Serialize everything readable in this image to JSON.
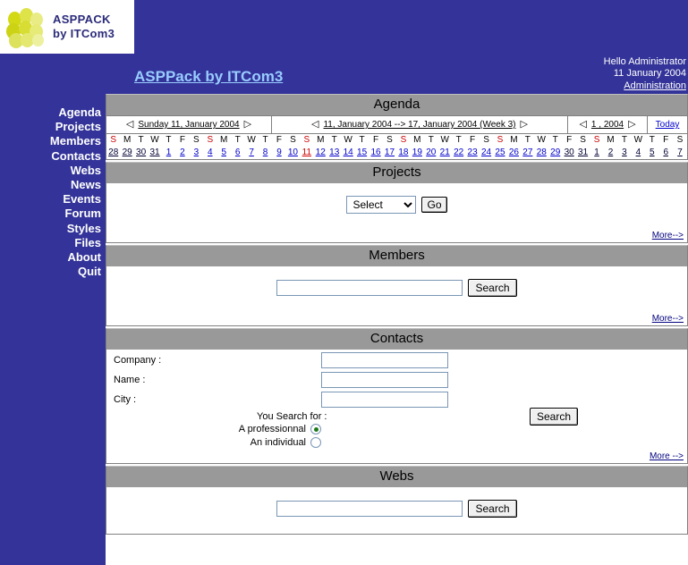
{
  "branding": {
    "logo_line1": "ASPPACK",
    "logo_line2": "by ITCom3",
    "site_title": "ASPPack by ITCom3",
    "accent_blue": "#333399",
    "link_blue": "#0000cc",
    "panel_gray": "#999999",
    "logo_yellow": "#d8dd33"
  },
  "user": {
    "greeting": "Hello  Administrator",
    "date": "11 January 2004",
    "admin_link": "Administration"
  },
  "sidebar": {
    "items": [
      {
        "label": "Agenda"
      },
      {
        "label": "Projects"
      },
      {
        "label": "Members"
      },
      {
        "label": "Contacts"
      },
      {
        "label": "Webs"
      },
      {
        "label": "News"
      },
      {
        "label": "Events"
      },
      {
        "label": "Forum"
      },
      {
        "label": "Styles"
      },
      {
        "label": "Files"
      },
      {
        "label": "About"
      },
      {
        "label": "Quit"
      }
    ]
  },
  "agenda": {
    "title": "Agenda",
    "day_label": "Sunday 11, January 2004",
    "week_label": "11, January 2004 --> 17, January 2004  (Week 3)",
    "year_label": "1 , 2004",
    "today_label": "Today",
    "prev_arrow": "◁",
    "next_arrow": "▷",
    "dow": [
      "S",
      "M",
      "T",
      "W",
      "T",
      "F",
      "S",
      "S",
      "M",
      "T",
      "W",
      "T",
      "F",
      "S",
      "S",
      "M",
      "T",
      "W",
      "T",
      "F",
      "S",
      "S",
      "M",
      "T",
      "W",
      "T",
      "F",
      "S",
      "S",
      "M",
      "T",
      "W",
      "T",
      "F",
      "S"
    ],
    "days": [
      {
        "n": "28",
        "style": "dark"
      },
      {
        "n": "29",
        "style": "dark"
      },
      {
        "n": "30",
        "style": "dark"
      },
      {
        "n": "31",
        "style": "dark"
      },
      {
        "n": "1",
        "style": "blue"
      },
      {
        "n": "2",
        "style": "blue"
      },
      {
        "n": "3",
        "style": "blue"
      },
      {
        "n": "4",
        "style": "blue"
      },
      {
        "n": "5",
        "style": "blue"
      },
      {
        "n": "6",
        "style": "blue"
      },
      {
        "n": "7",
        "style": "blue"
      },
      {
        "n": "8",
        "style": "blue"
      },
      {
        "n": "9",
        "style": "blue"
      },
      {
        "n": "10",
        "style": "blue"
      },
      {
        "n": "11",
        "style": "today"
      },
      {
        "n": "12",
        "style": "blue"
      },
      {
        "n": "13",
        "style": "blue"
      },
      {
        "n": "14",
        "style": "blue"
      },
      {
        "n": "15",
        "style": "blue"
      },
      {
        "n": "16",
        "style": "blue"
      },
      {
        "n": "17",
        "style": "blue"
      },
      {
        "n": "18",
        "style": "blue"
      },
      {
        "n": "19",
        "style": "blue"
      },
      {
        "n": "20",
        "style": "blue"
      },
      {
        "n": "21",
        "style": "blue"
      },
      {
        "n": "22",
        "style": "blue"
      },
      {
        "n": "23",
        "style": "blue"
      },
      {
        "n": "24",
        "style": "blue"
      },
      {
        "n": "25",
        "style": "blue"
      },
      {
        "n": "26",
        "style": "blue"
      },
      {
        "n": "27",
        "style": "blue"
      },
      {
        "n": "28",
        "style": "blue"
      },
      {
        "n": "29",
        "style": "blue"
      },
      {
        "n": "30",
        "style": "dark"
      },
      {
        "n": "31",
        "style": "dark"
      },
      {
        "n": "1",
        "style": "dark"
      },
      {
        "n": "2",
        "style": "dark"
      },
      {
        "n": "3",
        "style": "dark"
      },
      {
        "n": "4",
        "style": "dark"
      },
      {
        "n": "5",
        "style": "dark"
      },
      {
        "n": "6",
        "style": "dark"
      },
      {
        "n": "7",
        "style": "dark"
      }
    ]
  },
  "projects": {
    "title": "Projects",
    "select_value": "Select",
    "select_options": [
      "Select"
    ],
    "go_label": "Go",
    "more_label": "More-->"
  },
  "members": {
    "title": "Members",
    "search_value": "",
    "search_button": "Search",
    "more_label": "More-->"
  },
  "contacts": {
    "title": "Contacts",
    "company_label": "Company :",
    "company_value": "",
    "name_label": "Name :",
    "name_value": "",
    "city_label": "City :",
    "city_value": "",
    "search_for_label": "You Search for :",
    "option_professional": "A professionnal",
    "option_individual": "An individual",
    "selected_option": "A professionnal",
    "search_button": "Search",
    "more_label": "More -->"
  },
  "webs": {
    "title": "Webs",
    "search_value": "",
    "search_button": "Search"
  }
}
